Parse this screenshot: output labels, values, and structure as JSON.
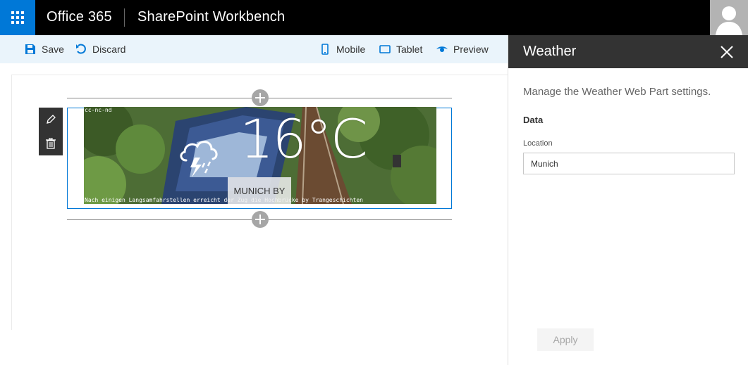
{
  "topbar": {
    "brand": "Office 365",
    "app_title": "SharePoint Workbench"
  },
  "commandbar": {
    "save": "Save",
    "discard": "Discard",
    "mobile": "Mobile",
    "tablet": "Tablet",
    "preview": "Preview"
  },
  "webpart": {
    "temperature": "16°C",
    "location": "MUNICH BY",
    "photo_credit_top": "cc-nc-nd",
    "photo_credit_bottom": "Nach einigen Langsamfahrstellen erreicht der Zug die Hochbrücke by Trangeschichten",
    "condition_icon": "thunderstorm-icon"
  },
  "pane": {
    "title": "Weather",
    "description": "Manage the Weather Web Part settings.",
    "group_name": "Data",
    "location_label": "Location",
    "location_value": "Munich",
    "apply_label": "Apply"
  },
  "colors": {
    "brand_blue": "#0078d7",
    "topbar": "#000000",
    "pane_header": "#333333",
    "commandbar_bg": "#eaf4fb"
  }
}
